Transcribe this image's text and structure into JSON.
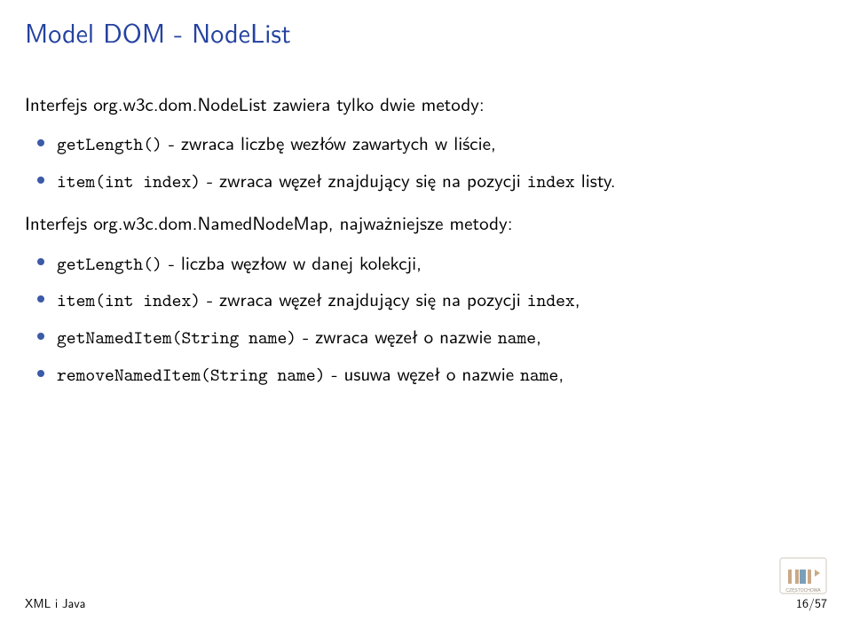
{
  "title": "Model DOM - NodeList",
  "p1_prefix": "Interfejs ",
  "p1_class": "org.w3c.dom.NodeList",
  "p1_suffix": " zawiera tylko dwie metody:",
  "list1": {
    "i0_code": "getLength()",
    "i0_text": " - zwraca liczbę wezłów zawartych w liście,",
    "i1_code": "item(int index)",
    "i1_text": " - zwraca węzeł znajdujący się na pozycji ",
    "i1_code2": "index",
    "i1_text2": " listy."
  },
  "p2_prefix": "Interfejs ",
  "p2_class": "org.w3c.dom.NamedNodeMap",
  "p2_suffix": ", najważniejsze metody:",
  "list2": {
    "i0_code": "getLength()",
    "i0_text": " - liczba węzłow w danej kolekcji,",
    "i1_code": "item(int index)",
    "i1_text": " - zwraca węzeł znajdujący się na pozycji ",
    "i1_code2": "index",
    "i1_text2": ",",
    "i2_code": "getNamedItem(String name)",
    "i2_text": " - zwraca węzeł o nazwie ",
    "i2_code2": "name",
    "i2_text2": ",",
    "i3_code": "removeNamedItem(String name)",
    "i3_text": " - usuwa węzeł o nazwie ",
    "i3_code2": "name",
    "i3_text2": ","
  },
  "footer_left": "XML i Java",
  "footer_right": "16/57"
}
